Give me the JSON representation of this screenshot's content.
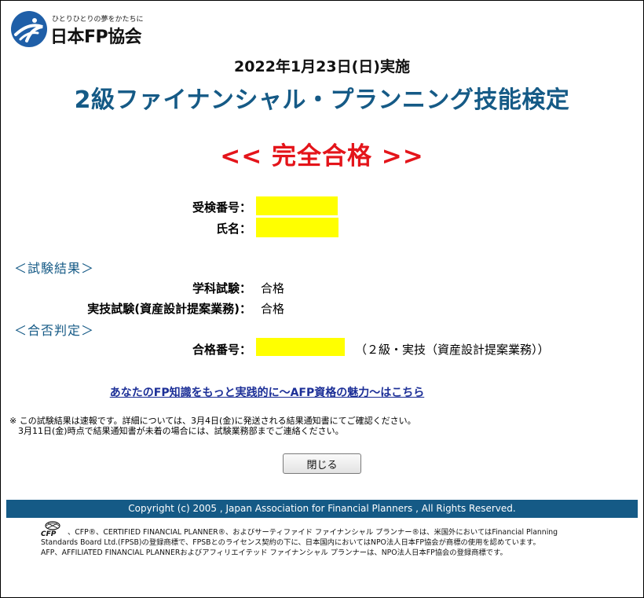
{
  "logo": {
    "tagline": "ひとりひとりの夢をかたちに",
    "name": "日本FP協会"
  },
  "header": {
    "date": "2022年1月23日(日)実施",
    "exam_title": "2級ファイナンシャル・プランニング技能検定",
    "result": "<< 完全合格 >>"
  },
  "applicant": {
    "exam_number_label": "受検番号：",
    "name_label": "氏名："
  },
  "results": {
    "section_title": "＜試験結果＞",
    "written_label": "学科試験：",
    "written_value": "合格",
    "practical_label": "実技試験(資産設計提案業務)：",
    "practical_value": "合格"
  },
  "judgement": {
    "section_title": "＜合否判定＞",
    "pass_number_label": "合格番号：",
    "pass_note": "（２級・実技（資産設計提案業務））"
  },
  "afp_link": "あなたのFP知識をもっと実践的に～AFP資格の魅力～はこちら",
  "notice": {
    "line1": "※ この試験結果は速報です。詳細については、3月4日(金)に発送される結果通知書にてご確認ください。",
    "line2": "　3月11日(金)時点で結果通知書が未着の場合には、試験業務部までご連絡ください。"
  },
  "buttons": {
    "close": "閉じる"
  },
  "footer": {
    "copyright": "Copyright (c) 2005 , Japan Association for Financial Planners , All Rights Reserved.",
    "cfp_mark": "CFP",
    "trademark_line1": "、CFP®、CERTIFIED FINANCIAL PLANNER®、およびサーティファイド ファイナンシャル プランナー®は、米国外においてはFinancial Planning",
    "trademark_line2": "Standards Board Ltd.(FPSB)の登録商標で、FPSBとのライセンス契約の下に、日本国内においてはNPO法人日本FP協会が商標の使用を認めています。",
    "trademark_line3": "AFP、AFFILIATED FINANCIAL PLANNERおよびアフィリエイテッド ファイナンシャル プランナーは、NPO法人日本FP協会の登録商標です。"
  },
  "colors": {
    "brand_blue": "#155a86",
    "result_red": "#e4141a",
    "mask_yellow": "#ffff00",
    "link_blue": "#1c2f97"
  }
}
